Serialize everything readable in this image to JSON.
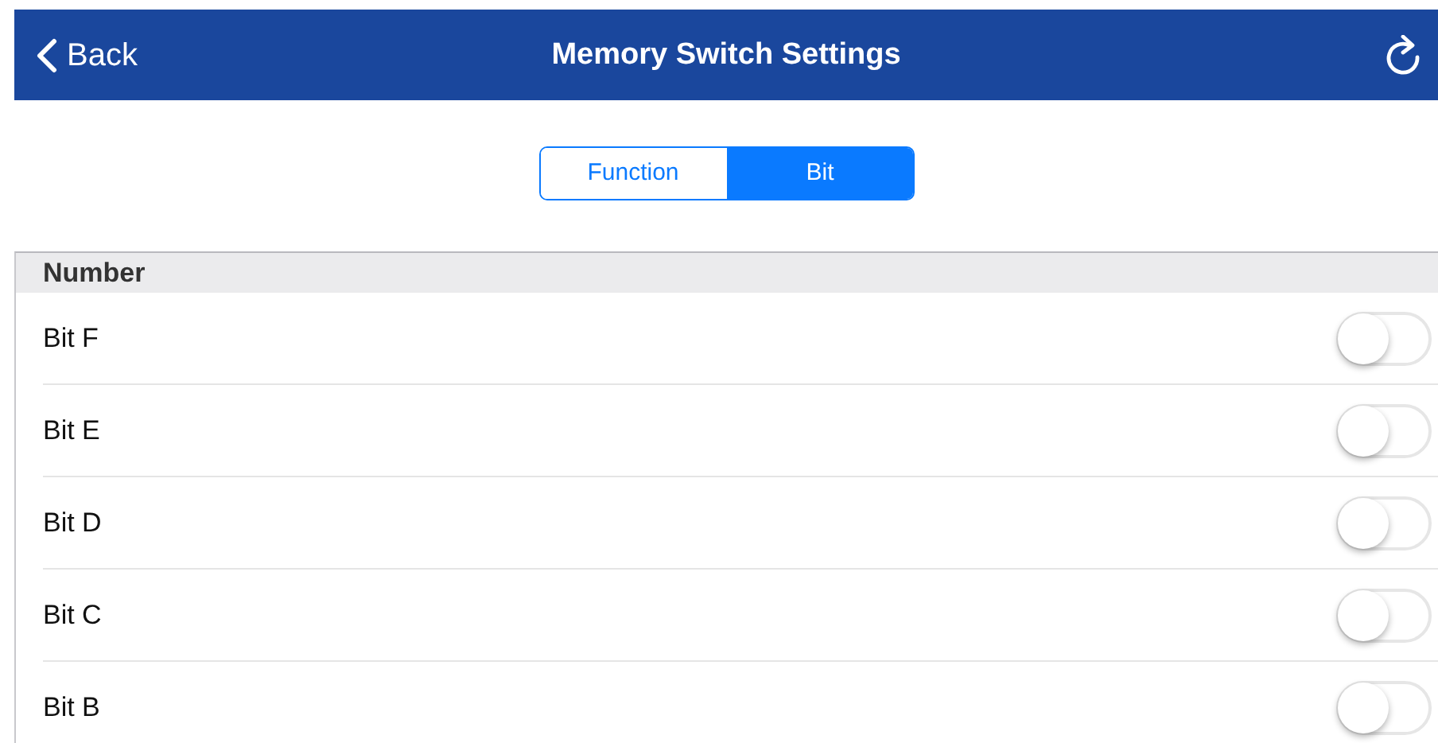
{
  "nav": {
    "back": "Back",
    "title": "Memory Switch Settings"
  },
  "segments": [
    {
      "label": "Function",
      "selected": false
    },
    {
      "label": "Bit",
      "selected": true
    }
  ],
  "section": {
    "header": "Number",
    "rows": [
      {
        "label": "Bit F",
        "on": false
      },
      {
        "label": "Bit E",
        "on": false
      },
      {
        "label": "Bit D",
        "on": false
      },
      {
        "label": "Bit C",
        "on": false
      },
      {
        "label": "Bit B",
        "on": false
      }
    ]
  }
}
